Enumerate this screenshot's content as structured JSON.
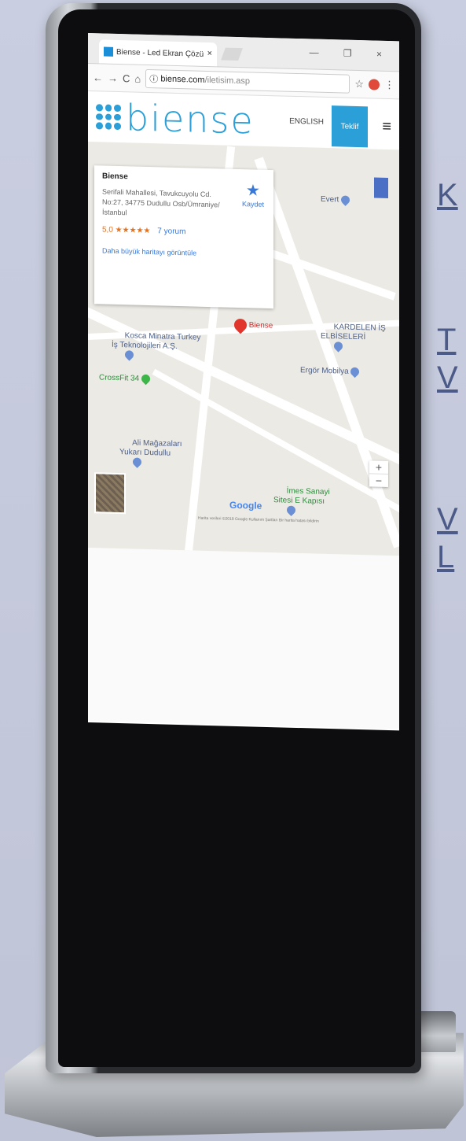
{
  "browser": {
    "tab_title": "Biense - Led Ekran Çözü",
    "tab_close": "×",
    "url_domain": "biense.com",
    "url_path": "/iletisim.asp",
    "window_controls": "— ❐ ×"
  },
  "site": {
    "logo_text": "biense",
    "lang_label": "ENGLISH",
    "teklif_label": "Teklif",
    "menu_icon": "≡"
  },
  "map": {
    "card": {
      "name": "Biense",
      "address": "Serifali Mahallesi, Tavukcuyolu Cd. No:27, 34775 Dudullu Osb/Ümraniye/İstanbul",
      "rating": "5,0 ★★★★★",
      "reviews": "7 yorum",
      "link": "Daha büyük haritayı görüntüle",
      "save_label": "Kaydet"
    },
    "pois": {
      "biense": "Biense",
      "kosca": "Kosca Minatra Turkey\nİş Teknolojileri A.Ş.",
      "crossfit": "CrossFit 34",
      "ali": "Ali Mağazaları\nYukarı Dudullu",
      "ergor": "Ergör Mobilya",
      "kardelen": "KARDELEN İŞ\nELBİSELERİ",
      "evert": "Evert",
      "imes": "İmes Sanayi\nSitesi E Kapısı"
    },
    "google": "Google",
    "copyright": "Harita verileri ©2018 Google   Kullanım Şartları   Bir harita hatası bildirin",
    "zoom_in": "+",
    "zoom_out": "−"
  },
  "side_letters": [
    "K",
    "T",
    "V",
    "V",
    "L"
  ],
  "colors": {
    "brand": "#2a9fd8",
    "background": "#c6cbdd",
    "side_text": "#4b5a86"
  }
}
